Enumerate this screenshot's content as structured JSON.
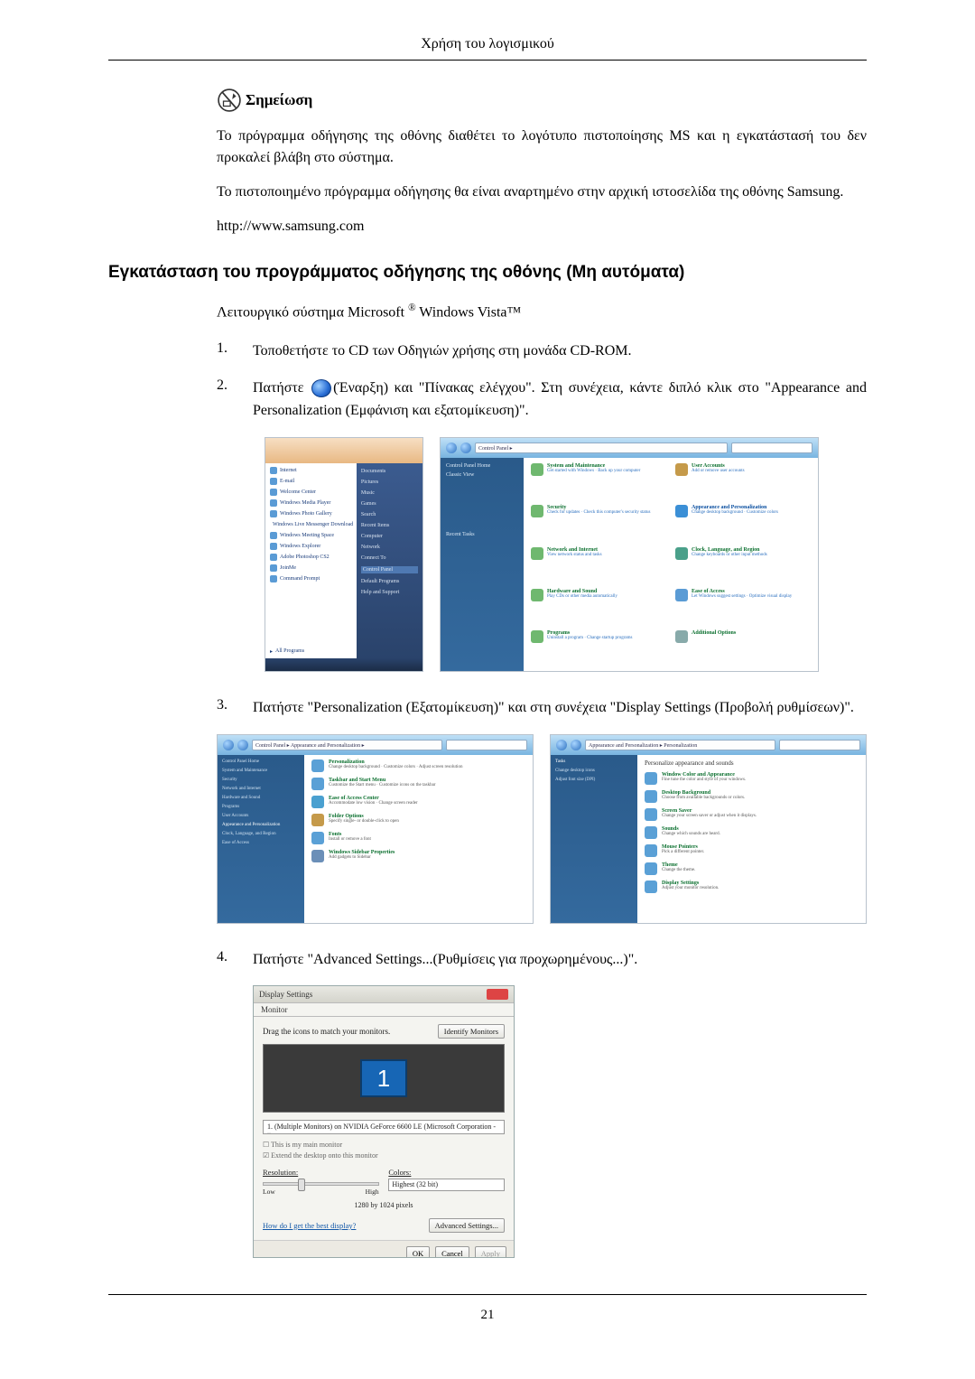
{
  "header": {
    "title": "Χρήση του λογισμικού"
  },
  "note": {
    "label": "Σημείωση",
    "p1": "Το πρόγραμμα οδήγησης της οθόνης διαθέτει το λογότυπο πιστοποίησης MS και η εγκατάστασή του δεν προκαλεί βλάβη στο σύστημα.",
    "p2": "Το πιστοποιημένο πρόγραμμα οδήγησης θα είναι αναρτημένο στην αρχική ιστοσελίδα της οθόνης Samsung.",
    "url": "http://www.samsung.com"
  },
  "section": {
    "heading": "Εγκατάσταση του προγράμματος οδήγησης της οθόνης (Μη αυτόματα)",
    "os_prefix": "Λειτουργικό σύστημα Microsoft ",
    "os_suffix": " Windows Vista™"
  },
  "steps": {
    "s1": {
      "num": "1.",
      "text": "Τοποθετήστε το CD των Οδηγιών χρήσης στη μονάδα CD-ROM."
    },
    "s2": {
      "num": "2.",
      "pre": "Πατήστε ",
      "post": "(Έναρξη) και \"Πίνακας ελέγχου\". Στη συνέχεια, κάντε διπλό κλικ στο \"Appearance and Personalization (Εμφάνιση και εξατομίκευση)\"."
    },
    "s3": {
      "num": "3.",
      "text": "Πατήστε \"Personalization (Εξατομίκευση)\" και στη συνέχεια \"Display Settings (Προβολή ρυθμίσεων)\"."
    },
    "s4": {
      "num": "4.",
      "text": "Πατήστε \"Advanced Settings...(Ρυθμίσεις για προχωρημένους...)\"."
    }
  },
  "startmenu": {
    "items": [
      "Internet",
      "E-mail",
      "Welcome Center",
      "Windows Media Player",
      "Windows Photo Gallery",
      "Windows Live Messenger Download",
      "Windows Meeting Space",
      "Windows Explorer",
      "Adobe Photoshop CS2",
      "JoinMe",
      "Command Prompt",
      "All Programs"
    ],
    "right": [
      "Documents",
      "Pictures",
      "Music",
      "Games",
      "Search",
      "Recent Items",
      "Computer",
      "Network",
      "Connect To",
      "Control Panel",
      "Default Programs",
      "Help and Support"
    ]
  },
  "controlpanel": {
    "path": "Control Panel ▸",
    "side_title": "Control Panel Home",
    "side_classic": "Classic View",
    "categories": [
      {
        "t": "System and Maintenance",
        "s": "Get started with Windows · Back up your computer"
      },
      {
        "t": "User Accounts",
        "s": "Add or remove user accounts"
      },
      {
        "t": "Security",
        "s": "Check for updates · Check this computer's security status"
      },
      {
        "t": "Appearance and Personalization",
        "s": "Change desktop background · Customize colors"
      },
      {
        "t": "Network and Internet",
        "s": "View network status and tasks"
      },
      {
        "t": "Clock, Language, and Region",
        "s": "Change keyboards or other input methods"
      },
      {
        "t": "Hardware and Sound",
        "s": "Play CDs or other media automatically"
      },
      {
        "t": "Ease of Access",
        "s": "Let Windows suggest settings · Optimize visual display"
      },
      {
        "t": "Programs",
        "s": "Uninstall a program · Change startup programs"
      },
      {
        "t": "Additional Options",
        "s": ""
      }
    ],
    "recent_header": "Recent Tasks"
  },
  "appearance": {
    "path": "Control Panel ▸ Appearance and Personalization ▸",
    "side": [
      "Control Panel Home",
      "System and Maintenance",
      "Security",
      "Network and Internet",
      "Hardware and Sound",
      "Programs",
      "User Accounts",
      "Appearance and Personalization",
      "Clock, Language, and Region",
      "Ease of Access"
    ],
    "rows": [
      {
        "t": "Personalization",
        "s": "Change desktop background · Customize colors · Adjust screen resolution"
      },
      {
        "t": "Taskbar and Start Menu",
        "s": "Customize the Start menu · Customize icons on the taskbar"
      },
      {
        "t": "Ease of Access Center",
        "s": "Accommodate low vision · Change screen reader"
      },
      {
        "t": "Folder Options",
        "s": "Specify single- or double-click to open"
      },
      {
        "t": "Fonts",
        "s": "Install or remove a font"
      },
      {
        "t": "Windows Sidebar Properties",
        "s": "Add gadgets to Sidebar"
      }
    ]
  },
  "personalization": {
    "side": [
      "Tasks",
      "Change desktop icons",
      "Adjust font size (DPI)"
    ],
    "title": "Personalize appearance and sounds",
    "rows": [
      {
        "t": "Window Color and Appearance",
        "s": "Fine tune the color and style of your windows."
      },
      {
        "t": "Desktop Background",
        "s": "Choose from available backgrounds or colors."
      },
      {
        "t": "Screen Saver",
        "s": "Change your screen saver or adjust when it displays."
      },
      {
        "t": "Sounds",
        "s": "Change which sounds are heard."
      },
      {
        "t": "Mouse Pointers",
        "s": "Pick a different pointer."
      },
      {
        "t": "Theme",
        "s": "Change the theme."
      },
      {
        "t": "Display Settings",
        "s": "Adjust your monitor resolution."
      }
    ]
  },
  "display_settings": {
    "title": "Display Settings",
    "tab": "Monitor",
    "drag_text": "Drag the icons to match your monitors.",
    "identify_btn": "Identify Monitors",
    "monitor_num": "1",
    "dropdown": "1. (Multiple Monitors) on NVIDIA GeForce 6600 LE (Microsoft Corporation - ▾",
    "chk1": "This is my main monitor",
    "chk2": "Extend the desktop onto this monitor",
    "resolution_label": "Resolution:",
    "low": "Low",
    "high": "High",
    "res_value": "1280 by 1024 pixels",
    "colors_label": "Colors:",
    "colors_value": "Highest (32 bit)",
    "best_link": "How do I get the best display?",
    "adv_btn": "Advanced Settings...",
    "ok": "OK",
    "cancel": "Cancel",
    "apply": "Apply"
  },
  "page_number": "21"
}
